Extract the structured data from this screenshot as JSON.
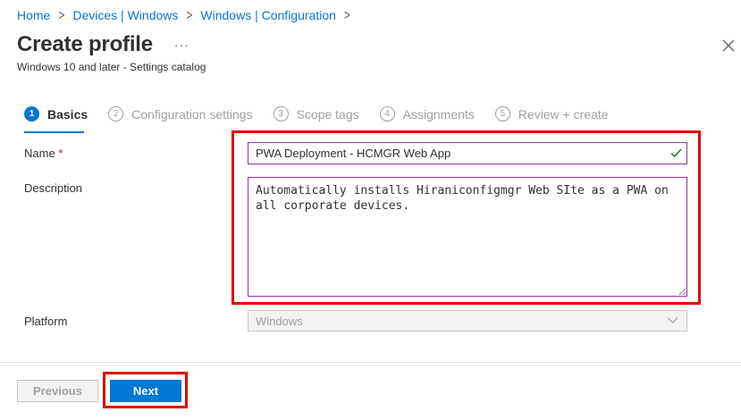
{
  "breadcrumb": {
    "items": [
      {
        "label": "Home"
      },
      {
        "label": "Devices | Windows"
      },
      {
        "label": "Windows | Configuration"
      }
    ],
    "separator": ">"
  },
  "header": {
    "title": "Create profile",
    "more": "···",
    "subtitle": "Windows 10 and later - Settings catalog"
  },
  "steps": [
    {
      "num": "1",
      "label": "Basics",
      "active": true
    },
    {
      "num": "2",
      "label": "Configuration settings",
      "active": false
    },
    {
      "num": "3",
      "label": "Scope tags",
      "active": false
    },
    {
      "num": "4",
      "label": "Assignments",
      "active": false
    },
    {
      "num": "5",
      "label": "Review + create",
      "active": false
    }
  ],
  "form": {
    "name_label": "Name",
    "required_mark": "*",
    "name_value": "PWA Deployment - HCMGR Web App",
    "description_label": "Description",
    "description_value": "Automatically installs Hiraniconfigmgr Web SIte as a PWA on all corporate devices.",
    "platform_label": "Platform",
    "platform_value": "Windows"
  },
  "footer": {
    "previous_label": "Previous",
    "next_label": "Next"
  },
  "colors": {
    "accent": "#0078d4",
    "highlight": "#e00000",
    "input_border": "#8a3a9c",
    "valid_check": "#107c10"
  },
  "icons": {
    "close": "close-icon",
    "check": "check-icon",
    "chevron": "chevron-down-icon",
    "more": "more-icon"
  }
}
